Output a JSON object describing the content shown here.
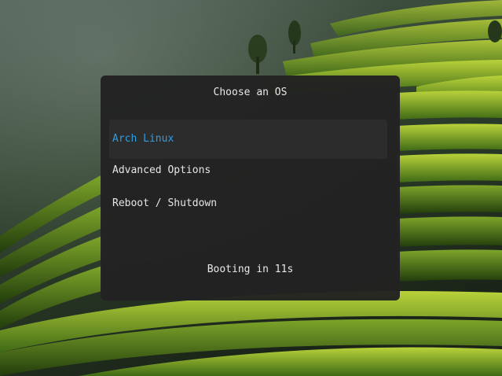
{
  "boot_menu": {
    "title": "Choose an OS",
    "entries": [
      {
        "label": "Arch Linux",
        "selected": true
      },
      {
        "label": "Advanced Options",
        "selected": false
      },
      {
        "label": "Reboot / Shutdown",
        "selected": false
      }
    ],
    "countdown": "Booting in 11s"
  },
  "colors": {
    "panel_background": "#222222",
    "selected_background": "#2c2c2c",
    "selected_text": "#2f9fe0",
    "text": "#e6e6e6"
  },
  "icons": {
    "wallpaper": "rice-terraces-wallpaper"
  }
}
